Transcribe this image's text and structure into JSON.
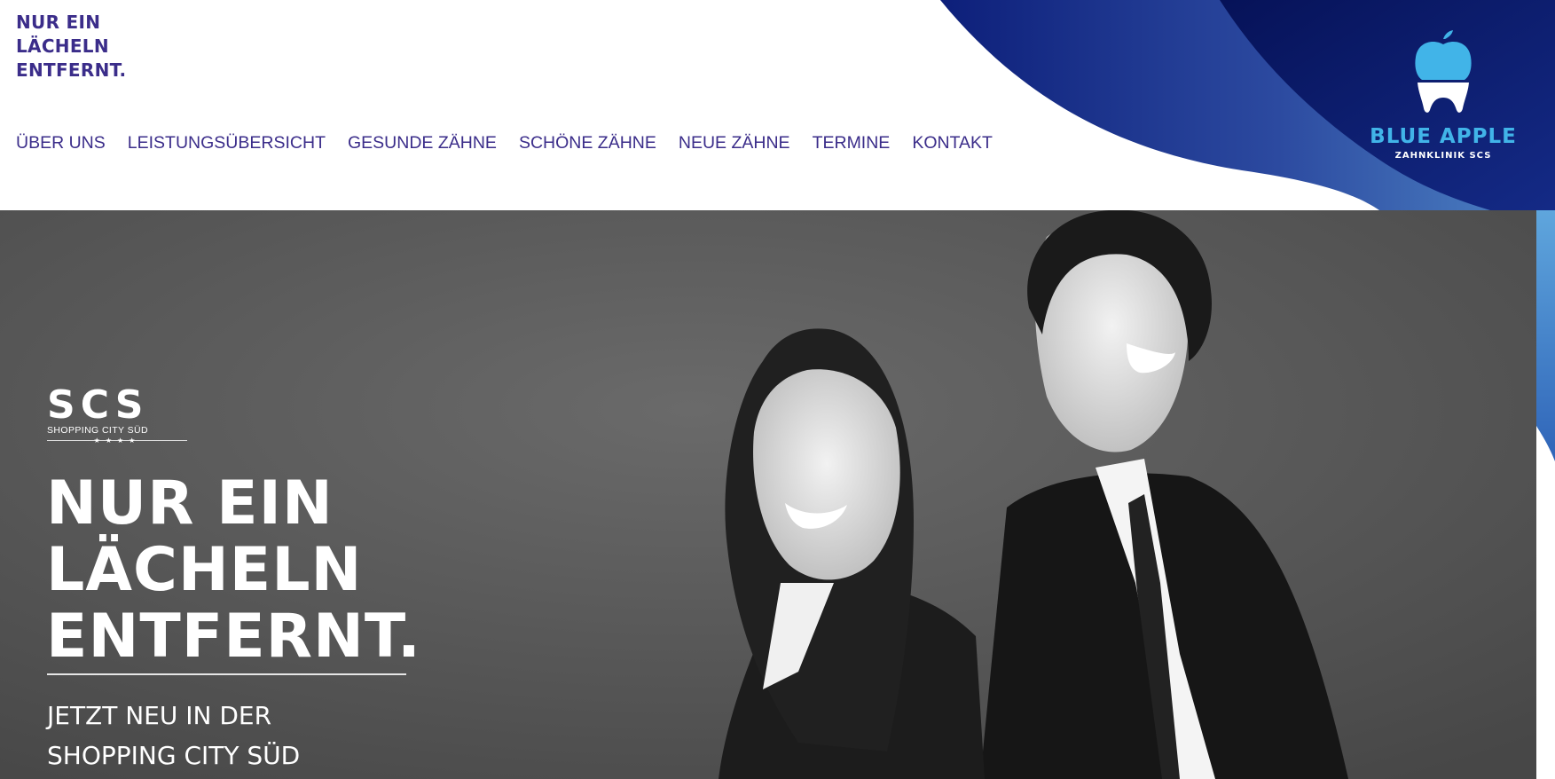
{
  "header": {
    "tagline": [
      "NUR EIN",
      "LÄCHELN",
      "ENTFERNT."
    ],
    "nav": [
      "ÜBER UNS",
      "LEISTUNGSÜBERSICHT",
      "GESUNDE ZÄHNE",
      "SCHÖNE ZÄHNE",
      "NEUE ZÄHNE",
      "TERMINE",
      "KONTAKT"
    ],
    "logo": {
      "name": "BLUE APPLE",
      "subtitle": "ZAHNKLINIK SCS",
      "icon": "apple-tooth-icon"
    }
  },
  "hero": {
    "partner_logo": {
      "word": "SCS",
      "sub": "SHOPPING CITY SÜD",
      "stars": "★★★★"
    },
    "title": [
      "NUR EIN",
      "LÄCHELN",
      "ENTFERNT."
    ],
    "subtitle": [
      "JETZT NEU IN DER",
      "SHOPPING CITY SÜD"
    ],
    "image": "black-and-white-photo-smiling-woman-and-man"
  },
  "colors": {
    "primary": "#3b2d8a",
    "brand_light": "#41b4e8",
    "brand_dark": "#0a1a6e"
  }
}
